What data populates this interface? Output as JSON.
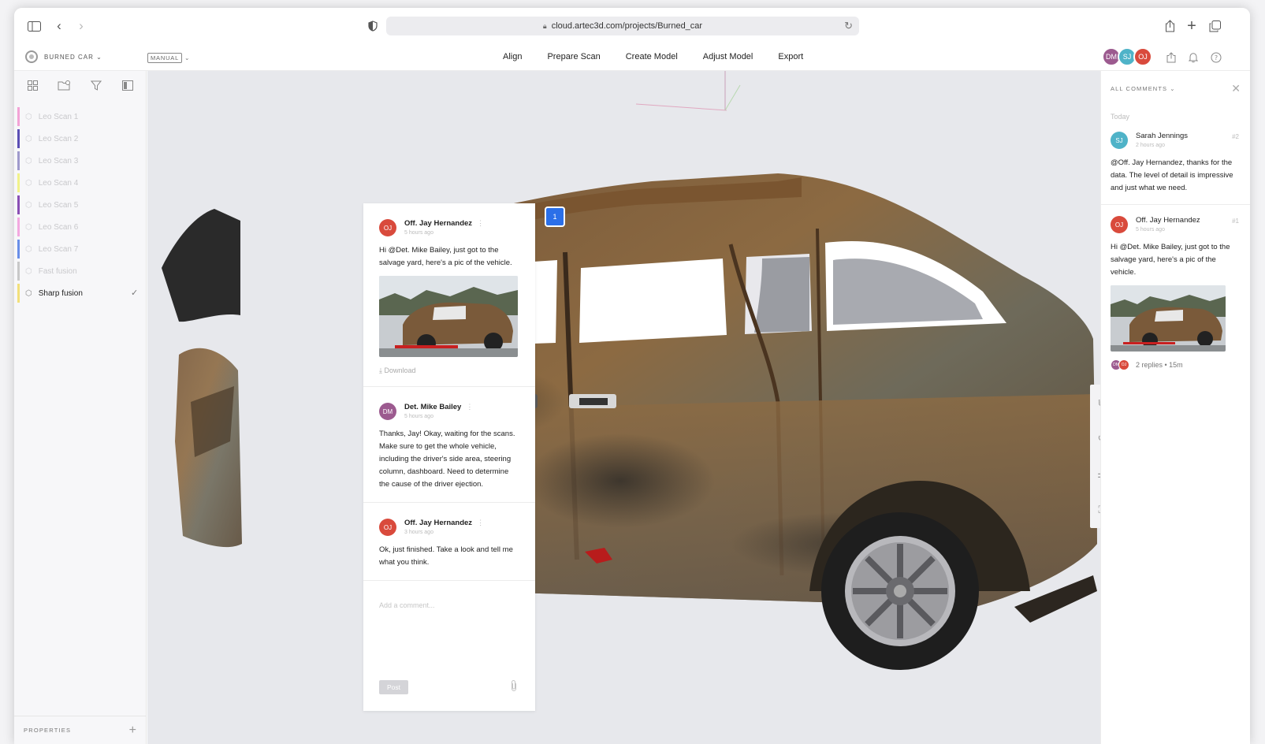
{
  "browser": {
    "url": "cloud.artec3d.com/projects/Burned_car"
  },
  "app": {
    "project_name": "BURNED CAR ⌄",
    "mode": "MANUAL",
    "mode_chevron": "⌄",
    "menu": [
      "Align",
      "Prepare Scan",
      "Create Model",
      "Adjust Model",
      "Export"
    ],
    "users": [
      {
        "initials": "DM",
        "color": "#9c5a8f"
      },
      {
        "initials": "SJ",
        "color": "#4fb3c8"
      },
      {
        "initials": "OJ",
        "color": "#d94a3c"
      }
    ]
  },
  "sidebar": {
    "scans": [
      {
        "label": "Leo Scan 1",
        "color": "#f3a3d6"
      },
      {
        "label": "Leo Scan 2",
        "color": "#5c4fb5"
      },
      {
        "label": "Leo Scan 3",
        "color": "#9f9acc"
      },
      {
        "label": "Leo Scan 4",
        "color": "#f1f28a"
      },
      {
        "label": "Leo Scan 5",
        "color": "#8a4fb5"
      },
      {
        "label": "Leo Scan 6",
        "color": "#f3a8e0"
      },
      {
        "label": "Leo Scan 7",
        "color": "#6a8fe8"
      },
      {
        "label": "Fast fusion",
        "color": "#c8c8c8"
      },
      {
        "label": "Sharp fusion",
        "color": "#f2e07a"
      }
    ],
    "properties_label": "PROPERTIES"
  },
  "thread": {
    "pin_number": "1",
    "messages": [
      {
        "initials": "OJ",
        "color": "#d94a3c",
        "author": "Off. Jay Hernandez",
        "time": "5 hours ago",
        "text": "Hi @Det. Mike Bailey, just got to the salvage yard, here's a pic of the vehicle.",
        "download_label": "Download"
      },
      {
        "initials": "DM",
        "color": "#9c5a8f",
        "author": "Det. Mike Bailey",
        "time": "5 hours ago",
        "text": "Thanks, Jay! Okay, waiting for the scans. Make sure to get the whole vehicle, including the driver's side area, steering column, dashboard. Need to determine the cause of the driver ejection."
      },
      {
        "initials": "OJ",
        "color": "#d94a3c",
        "author": "Off. Jay Hernandez",
        "time": "3 hours ago",
        "text": "Ok, just finished. Take a look and tell me what you think."
      }
    ],
    "input_placeholder": "Add a comment...",
    "post_label": "Post"
  },
  "comments_panel": {
    "header": "ALL COMMENTS ⌄",
    "section": "Today",
    "cards": [
      {
        "initials": "SJ",
        "color": "#4fb3c8",
        "author": "Sarah Jennings",
        "time": "2 hours ago",
        "number": "#2",
        "text": "@Off. Jay Hernandez, thanks for the data. The level of detail is impressive and just what we need."
      },
      {
        "initials": "OJ",
        "color": "#d94a3c",
        "author": "Off. Jay Hernandez",
        "time": "5 hours ago",
        "number": "#1",
        "text": "Hi @Det. Mike Bailey, just got to the salvage yard, here's a pic of the vehicle.",
        "replies": "2 replies • 15m"
      }
    ]
  }
}
